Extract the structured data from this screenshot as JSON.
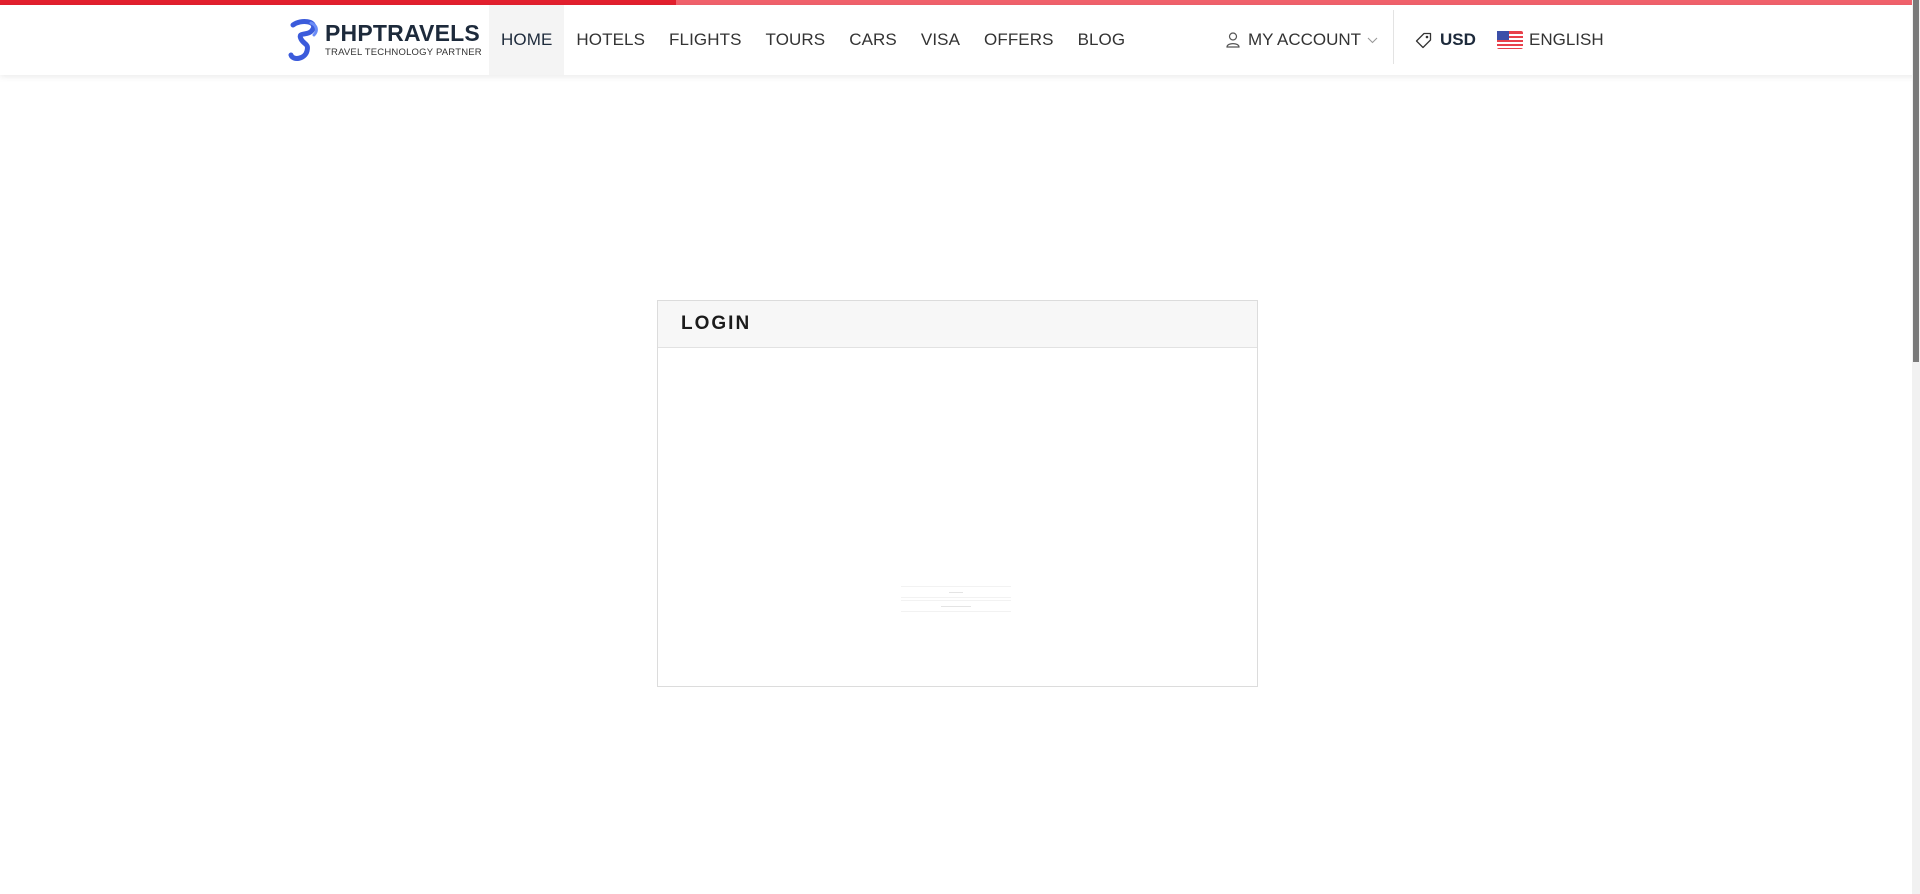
{
  "progress": {
    "fraction": 0.352,
    "fill_color": "#e2202e",
    "track_color": "#f0616b"
  },
  "logo": {
    "title": "PHPTRAVELS",
    "subtitle": "TRAVEL TECHNOLOGY PARTNER",
    "mark_color": "#3b5bdb"
  },
  "nav": {
    "items": [
      {
        "label": "HOME",
        "active": true
      },
      {
        "label": "HOTELS"
      },
      {
        "label": "FLIGHTS"
      },
      {
        "label": "TOURS"
      },
      {
        "label": "CARS"
      },
      {
        "label": "VISA"
      },
      {
        "label": "OFFERS"
      },
      {
        "label": "BLOG"
      }
    ]
  },
  "account": {
    "label": "MY ACCOUNT",
    "icon": "user-icon",
    "chevron": "chevron-down-icon"
  },
  "currency": {
    "label": "USD",
    "icon": "tag-icon"
  },
  "language": {
    "label": "ENGLISH",
    "flag": "us-flag-icon"
  },
  "login": {
    "title": "LOGIN"
  },
  "scrollbar": {
    "position_fraction": 0.0
  }
}
